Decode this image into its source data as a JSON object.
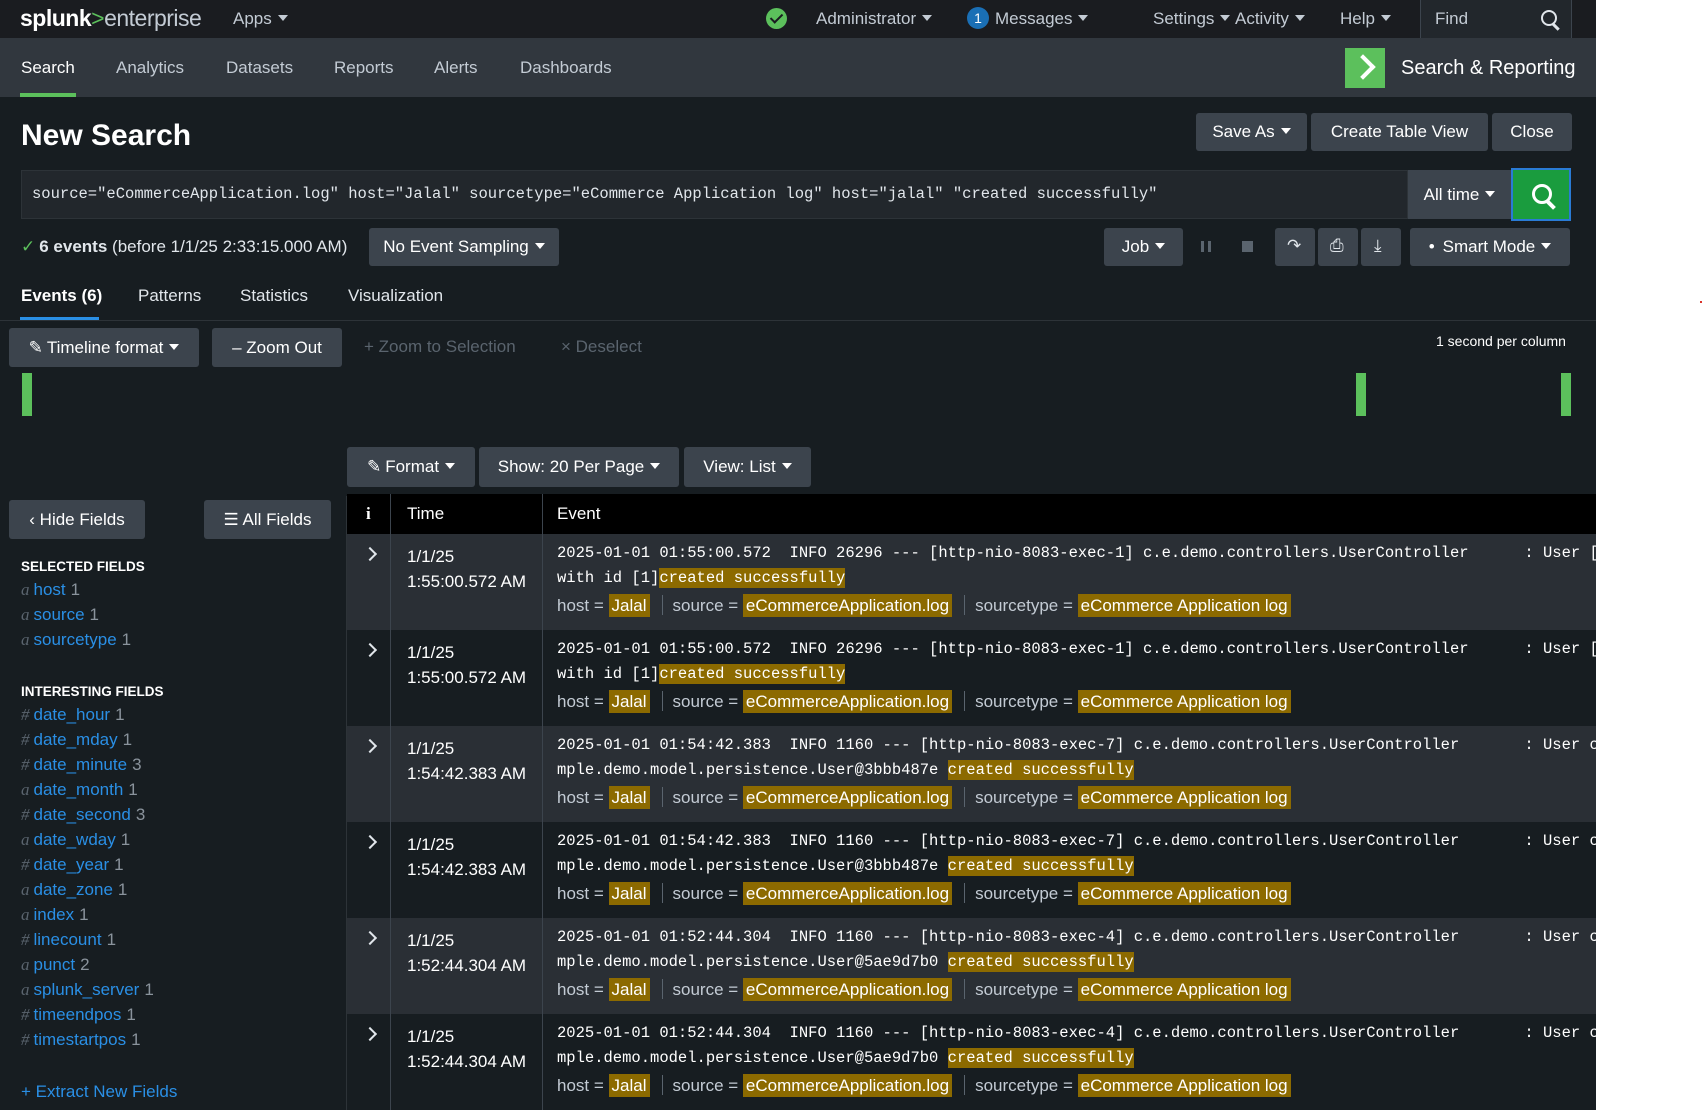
{
  "topbar": {
    "logo_brand": "splunk",
    "logo_gt": ">",
    "logo_product": "enterprise",
    "apps": "Apps",
    "user": "Administrator",
    "messages_count": "1",
    "messages": "Messages",
    "settings": "Settings",
    "activity": "Activity",
    "help": "Help",
    "find_placeholder": "Find"
  },
  "appbar": {
    "tabs": [
      "Search",
      "Analytics",
      "Datasets",
      "Reports",
      "Alerts",
      "Dashboards"
    ],
    "active_tab": "Search",
    "app_title": "Search & Reporting"
  },
  "page": {
    "title": "New Search",
    "save_as": "Save As",
    "create_table_view": "Create Table View",
    "close": "Close"
  },
  "search": {
    "query": "source=\"eCommerceApplication.log\" host=\"Jalal\" sourcetype=\"eCommerce Application log\" host=\"jalal\" \"created successfully\"",
    "time_range": "All time"
  },
  "status": {
    "check": "✓",
    "count_text": "6 events",
    "before_text": "(before 1/1/25 2:33:15.000 AM)",
    "sampling": "No Event Sampling",
    "job": "Job",
    "mode": "Smart Mode"
  },
  "result_tabs": [
    "Events (6)",
    "Patterns",
    "Statistics",
    "Visualization"
  ],
  "timeline": {
    "format": "Timeline format",
    "zoom_out": "Zoom Out",
    "zoom_selection": "Zoom to Selection",
    "deselect": "Deselect",
    "scale": "1 second per column"
  },
  "results_toolbar": {
    "format": "Format",
    "per_page": "Show: 20 Per Page",
    "view": "View: List"
  },
  "sidebar": {
    "hide_fields": "Hide Fields",
    "all_fields": "All Fields",
    "selected_heading": "SELECTED FIELDS",
    "selected": [
      {
        "type": "a",
        "name": "host",
        "count": "1"
      },
      {
        "type": "a",
        "name": "source",
        "count": "1"
      },
      {
        "type": "a",
        "name": "sourcetype",
        "count": "1"
      }
    ],
    "interesting_heading": "INTERESTING FIELDS",
    "interesting": [
      {
        "type": "#",
        "name": "date_hour",
        "count": "1"
      },
      {
        "type": "#",
        "name": "date_mday",
        "count": "1"
      },
      {
        "type": "#",
        "name": "date_minute",
        "count": "3"
      },
      {
        "type": "a",
        "name": "date_month",
        "count": "1"
      },
      {
        "type": "#",
        "name": "date_second",
        "count": "3"
      },
      {
        "type": "a",
        "name": "date_wday",
        "count": "1"
      },
      {
        "type": "#",
        "name": "date_year",
        "count": "1"
      },
      {
        "type": "a",
        "name": "date_zone",
        "count": "1"
      },
      {
        "type": "a",
        "name": "index",
        "count": "1"
      },
      {
        "type": "#",
        "name": "linecount",
        "count": "1"
      },
      {
        "type": "a",
        "name": "punct",
        "count": "2"
      },
      {
        "type": "a",
        "name": "splunk_server",
        "count": "1"
      },
      {
        "type": "#",
        "name": "timeendpos",
        "count": "1"
      },
      {
        "type": "#",
        "name": "timestartpos",
        "count": "1"
      }
    ],
    "extract": "Extract New Fields"
  },
  "table": {
    "col_info": "i",
    "col_time": "Time",
    "col_event": "Event",
    "meta_host_label": "host =",
    "meta_source_label": "source =",
    "meta_sourcetype_label": "sourcetype =",
    "rows": [
      {
        "date": "1/1/25",
        "clock": "1:55:00.572 AM",
        "line1": "2025-01-01 01:55:00.572  INFO 26296 --- [http-nio-8083-exec-1] c.e.demo.controllers.UserController      : User [test]",
        "line2_pre": "with id [1]",
        "highlight": "created successfully",
        "host": "Jalal",
        "source": "eCommerceApplication.log",
        "sourcetype": "eCommerce Application log"
      },
      {
        "date": "1/1/25",
        "clock": "1:55:00.572 AM",
        "line1": "2025-01-01 01:55:00.572  INFO 26296 --- [http-nio-8083-exec-1] c.e.demo.controllers.UserController      : User [test]",
        "line2_pre": "with id [1]",
        "highlight": "created successfully",
        "host": "Jalal",
        "source": "eCommerceApplication.log",
        "sourcetype": "eCommerce Application log"
      },
      {
        "date": "1/1/25",
        "clock": "1:54:42.383 AM",
        "line1": "2025-01-01 01:54:42.383  INFO 1160 --- [http-nio-8083-exec-7] c.e.demo.controllers.UserController       : User com.exa",
        "line2_pre": "mple.demo.model.persistence.User@3bbb487e ",
        "highlight": "created successfully",
        "host": "Jalal",
        "source": "eCommerceApplication.log",
        "sourcetype": "eCommerce Application log"
      },
      {
        "date": "1/1/25",
        "clock": "1:54:42.383 AM",
        "line1": "2025-01-01 01:54:42.383  INFO 1160 --- [http-nio-8083-exec-7] c.e.demo.controllers.UserController       : User com.exa",
        "line2_pre": "mple.demo.model.persistence.User@3bbb487e ",
        "highlight": "created successfully",
        "host": "Jalal",
        "source": "eCommerceApplication.log",
        "sourcetype": "eCommerce Application log"
      },
      {
        "date": "1/1/25",
        "clock": "1:52:44.304 AM",
        "line1": "2025-01-01 01:52:44.304  INFO 1160 --- [http-nio-8083-exec-4] c.e.demo.controllers.UserController       : User com.exa",
        "line2_pre": "mple.demo.model.persistence.User@5ae9d7b0 ",
        "highlight": "created successfully",
        "host": "Jalal",
        "source": "eCommerceApplication.log",
        "sourcetype": "eCommerce Application log"
      },
      {
        "date": "1/1/25",
        "clock": "1:52:44.304 AM",
        "line1": "2025-01-01 01:52:44.304  INFO 1160 --- [http-nio-8083-exec-4] c.e.demo.controllers.UserController       : User com.exa",
        "line2_pre": "mple.demo.model.persistence.User@5ae9d7b0 ",
        "highlight": "created successfully",
        "host": "Jalal",
        "source": "eCommerceApplication.log",
        "sourcetype": "eCommerce Application log"
      }
    ]
  },
  "colors": {
    "accent_green": "#5cc05c",
    "link_blue": "#2a8fe5",
    "highlight": "#8c6a00",
    "background": "#171d21"
  }
}
